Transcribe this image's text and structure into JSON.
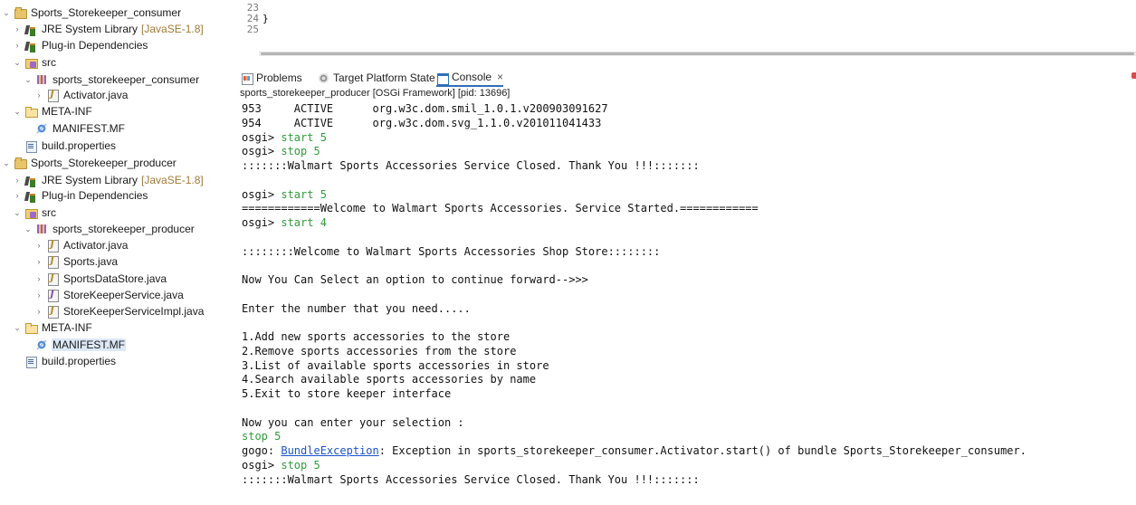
{
  "explorer": {
    "items": [
      {
        "twisty": "⌄",
        "icon": "project-icon",
        "label": "Sports_Storekeeper_consumer",
        "suffix": "",
        "selected": false
      },
      {
        "twisty": "›",
        "icon": "library-icon",
        "label": "JRE System Library",
        "suffix": "[JavaSE-1.8]",
        "selected": false
      },
      {
        "twisty": "›",
        "icon": "library-icon",
        "label": "Plug-in Dependencies",
        "suffix": "",
        "selected": false
      },
      {
        "twisty": "⌄",
        "icon": "source-folder-icon",
        "label": "src",
        "suffix": "",
        "selected": false
      },
      {
        "twisty": "⌄",
        "icon": "package-icon",
        "label": "sports_storekeeper_consumer",
        "suffix": "",
        "selected": false
      },
      {
        "twisty": "›",
        "icon": "java-file-icon",
        "label": "Activator.java",
        "suffix": "",
        "selected": false
      },
      {
        "twisty": "⌄",
        "icon": "folder-icon",
        "label": "META-INF",
        "suffix": "",
        "selected": false
      },
      {
        "twisty": "",
        "icon": "manifest-icon",
        "label": "MANIFEST.MF",
        "suffix": "",
        "selected": false
      },
      {
        "twisty": "",
        "icon": "properties-file-icon",
        "label": "build.properties",
        "suffix": "",
        "selected": false
      },
      {
        "twisty": "⌄",
        "icon": "project-icon",
        "label": "Sports_Storekeeper_producer",
        "suffix": "",
        "selected": false
      },
      {
        "twisty": "›",
        "icon": "library-icon",
        "label": "JRE System Library",
        "suffix": "[JavaSE-1.8]",
        "selected": false
      },
      {
        "twisty": "›",
        "icon": "library-icon",
        "label": "Plug-in Dependencies",
        "suffix": "",
        "selected": false
      },
      {
        "twisty": "⌄",
        "icon": "source-folder-icon",
        "label": "src",
        "suffix": "",
        "selected": false
      },
      {
        "twisty": "⌄",
        "icon": "package-icon",
        "label": "sports_storekeeper_producer",
        "suffix": "",
        "selected": false
      },
      {
        "twisty": "›",
        "icon": "java-file-icon",
        "label": "Activator.java",
        "suffix": "",
        "selected": false
      },
      {
        "twisty": "›",
        "icon": "java-file-icon",
        "label": "Sports.java",
        "suffix": "",
        "selected": false
      },
      {
        "twisty": "›",
        "icon": "java-file-icon",
        "label": "SportsDataStore.java",
        "suffix": "",
        "selected": false
      },
      {
        "twisty": "›",
        "icon": "java-interface-icon",
        "label": "StoreKeeperService.java",
        "suffix": "",
        "selected": false
      },
      {
        "twisty": "›",
        "icon": "java-file-icon",
        "label": "StoreKeeperServiceImpl.java",
        "suffix": "",
        "selected": false
      },
      {
        "twisty": "⌄",
        "icon": "folder-icon",
        "label": "META-INF",
        "suffix": "",
        "selected": false
      },
      {
        "twisty": "",
        "icon": "manifest-icon",
        "label": "MANIFEST.MF",
        "suffix": "",
        "selected": true
      },
      {
        "twisty": "",
        "icon": "properties-file-icon",
        "label": "build.properties",
        "suffix": "",
        "selected": false
      }
    ]
  },
  "editor": {
    "lines": [
      {
        "num": "23",
        "code": ""
      },
      {
        "num": "24",
        "code": "}"
      },
      {
        "num": "25",
        "code": ""
      }
    ]
  },
  "console_view": {
    "tabs": [
      {
        "icon": "problems-icon",
        "label": "Problems",
        "active": false,
        "closable": false
      },
      {
        "icon": "target-platform-icon",
        "label": "Target Platform State",
        "active": false,
        "closable": false
      },
      {
        "icon": "console-icon",
        "label": "Console",
        "active": true,
        "closable": true
      }
    ],
    "close_glyph": "×",
    "header": "sports_storekeeper_producer [OSGi Framework]  [pid: 13696]",
    "lines": [
      [
        {
          "t": "953     ACTIVE      org.w3c.dom.smil_1.0.1.v200903091627",
          "s": "out"
        }
      ],
      [
        {
          "t": "954     ACTIVE      org.w3c.dom.svg_1.1.0.v201011041433",
          "s": "out"
        }
      ],
      [
        {
          "t": "osgi> ",
          "s": "out"
        },
        {
          "t": "start 5",
          "s": "in"
        }
      ],
      [
        {
          "t": "osgi> ",
          "s": "out"
        },
        {
          "t": "stop 5",
          "s": "in"
        }
      ],
      [
        {
          "t": ":::::::Walmart Sports Accessories Service Closed. Thank You !!!:::::::",
          "s": "out"
        }
      ],
      [
        {
          "t": "",
          "s": "out"
        }
      ],
      [
        {
          "t": "osgi> ",
          "s": "out"
        },
        {
          "t": "start 5",
          "s": "in"
        }
      ],
      [
        {
          "t": "============Welcome to Walmart Sports Accessories. Service Started.============",
          "s": "out"
        }
      ],
      [
        {
          "t": "osgi> ",
          "s": "out"
        },
        {
          "t": "start 4",
          "s": "in"
        }
      ],
      [
        {
          "t": "",
          "s": "out"
        }
      ],
      [
        {
          "t": "::::::::Welcome to Walmart Sports Accessories Shop Store::::::::",
          "s": "out"
        }
      ],
      [
        {
          "t": "",
          "s": "out"
        }
      ],
      [
        {
          "t": "Now You Can Select an option to continue forward-->>>",
          "s": "out"
        }
      ],
      [
        {
          "t": "",
          "s": "out"
        }
      ],
      [
        {
          "t": "Enter the number that you need.....",
          "s": "out"
        }
      ],
      [
        {
          "t": "",
          "s": "out"
        }
      ],
      [
        {
          "t": "1.Add new sports accessories to the store",
          "s": "out"
        }
      ],
      [
        {
          "t": "2.Remove sports accessories from the store",
          "s": "out"
        }
      ],
      [
        {
          "t": "3.List of available sports accessories in store",
          "s": "out"
        }
      ],
      [
        {
          "t": "4.Search available sports accessories by name",
          "s": "out"
        }
      ],
      [
        {
          "t": "5.Exit to store keeper interface",
          "s": "out"
        }
      ],
      [
        {
          "t": "",
          "s": "out"
        }
      ],
      [
        {
          "t": "Now you can enter your selection :",
          "s": "out"
        }
      ],
      [
        {
          "t": "stop 5",
          "s": "in"
        }
      ],
      [
        {
          "t": "gogo: ",
          "s": "out"
        },
        {
          "t": "BundleException",
          "s": "link"
        },
        {
          "t": ": Exception in sports_storekeeper_consumer.Activator.start() of bundle Sports_Storekeeper_consumer.",
          "s": "out"
        }
      ],
      [
        {
          "t": "osgi> ",
          "s": "out"
        },
        {
          "t": "stop 5",
          "s": "in"
        }
      ],
      [
        {
          "t": ":::::::Walmart Sports Accessories Service Closed. Thank You !!!:::::::",
          "s": "out"
        }
      ]
    ]
  }
}
